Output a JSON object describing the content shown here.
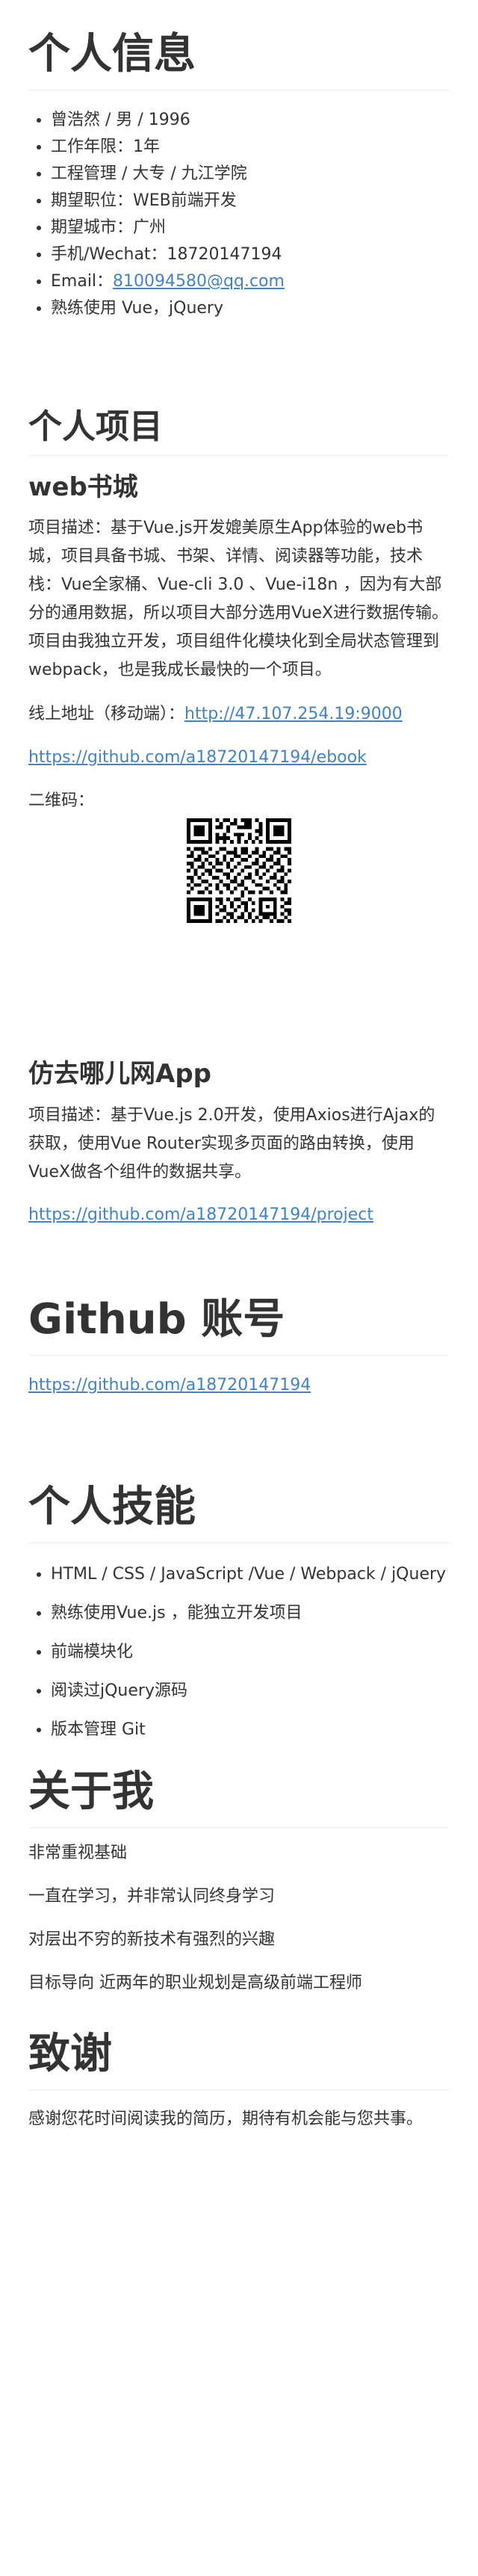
{
  "info": {
    "title": "个人信息",
    "items": [
      "曾浩然 / 男 / 1996",
      "工作年限：1年",
      "工程管理 / 大专 / 九江学院",
      "期望职位：WEB前端开发",
      "期望城市：广州",
      "手机/Wechat：18720147194"
    ],
    "email_label": "Email：",
    "email": "810094580@qq.com",
    "skill_line": "熟练使用 Vue，jQuery"
  },
  "projects": {
    "title": "个人项目",
    "p1": {
      "title": "web书城",
      "desc": "项目描述：基于Vue.js开发媲美原生App体验的web书城，项目具备书城、书架、详情、阅读器等功能，技术栈：Vue全家桶、Vue-cli 3.0 、Vue-i18n ，因为有大部分的通用数据，所以项目大部分选用VueX进行数据传输。项目由我独立开发，项目组件化模块化到全局状态管理到webpack，也是我成长最快的一个项目。",
      "online_label": "线上地址（移动端）：",
      "online_url": "http://47.107.254.19:9000",
      "github": "https://github.com/a18720147194/ebook",
      "qr_label": "二维码："
    },
    "p2": {
      "title": "仿去哪儿网App",
      "desc": "项目描述：基于Vue.js 2.0开发，使用Axios进行Ajax的获取，使用Vue Router实现多页面的路由转换，使用VueX做各个组件的数据共享。",
      "github": "https://github.com/a18720147194/project"
    }
  },
  "github": {
    "title": "Github 账号",
    "url": "https://github.com/a18720147194"
  },
  "skills": {
    "title": "个人技能",
    "items": [
      "HTML / CSS / JavaScript /Vue / Webpack / jQuery",
      "熟练使用Vue.js ，能独立开发项目",
      "前端模块化",
      "阅读过jQuery源码",
      "版本管理 Git"
    ]
  },
  "about": {
    "title": "关于我",
    "lines": [
      "非常重视基础",
      "一直在学习，并非常认同终身学习",
      "对层出不穷的新技术有强烈的兴趣",
      "目标导向 近两年的职业规划是高级前端工程师"
    ]
  },
  "thanks": {
    "title": "致谢",
    "text": "感谢您花时间阅读我的简历，期待有机会能与您共事。"
  },
  "colors": {
    "text": "#333333",
    "link": "#4183c4",
    "rule": "#eeeeee"
  }
}
